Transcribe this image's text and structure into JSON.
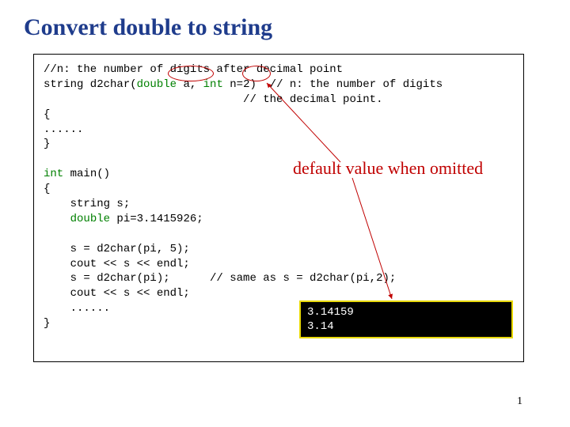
{
  "title": "Convert double to string",
  "code": {
    "l1": "//n: the number of digits after decimal point",
    "l2a": "string d2char(",
    "l2b": "double",
    "l2c": " a, ",
    "l2d": "int",
    "l2e": " n=2)  // n: the number of digits",
    "l3": "                              // the decimal point.",
    "l4": "{",
    "l5": "......",
    "l6": "}",
    "l7": "",
    "l8a": "int",
    "l8b": " main()",
    "l9": "{",
    "l10": "    string s;",
    "l11a": "    ",
    "l11b": "double",
    "l11c": " pi=3.1415926;",
    "l12": "",
    "l13": "    s = d2char(pi, 5);",
    "l14": "    cout << s << endl;",
    "l15": "    s = d2char(pi);      // same as s = d2char(pi,2);",
    "l16": "    cout << s << endl;",
    "l17": "    ......",
    "l18": "}"
  },
  "annotation": "default value when omitted",
  "output": {
    "line1": "3.14159",
    "line2": "3.14"
  },
  "page_number": "1"
}
